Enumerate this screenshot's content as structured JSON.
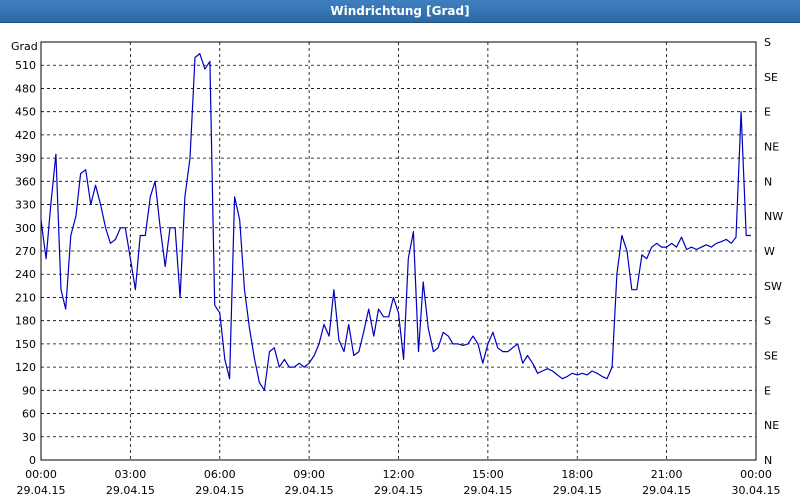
{
  "window": {
    "title": "Windrichtung [Grad]"
  },
  "chart_data": {
    "type": "line",
    "title": "Windrichtung [Grad]",
    "ylabel": "Grad",
    "ylim": [
      0,
      540
    ],
    "y_ticks": [
      0,
      30,
      60,
      90,
      120,
      150,
      180,
      210,
      240,
      270,
      300,
      330,
      360,
      390,
      420,
      450,
      480,
      510
    ],
    "right_axis_ticks": [
      {
        "value": 0,
        "label": "N"
      },
      {
        "value": 45,
        "label": "NE"
      },
      {
        "value": 90,
        "label": "E"
      },
      {
        "value": 135,
        "label": "SE"
      },
      {
        "value": 180,
        "label": "S"
      },
      {
        "value": 225,
        "label": "SW"
      },
      {
        "value": 270,
        "label": "W"
      },
      {
        "value": 315,
        "label": "NW"
      },
      {
        "value": 360,
        "label": "N"
      },
      {
        "value": 405,
        "label": "NE"
      },
      {
        "value": 450,
        "label": "E"
      },
      {
        "value": 495,
        "label": "SE"
      },
      {
        "value": 540,
        "label": "S"
      }
    ],
    "x_range_hours": [
      0,
      24
    ],
    "x_ticks": [
      {
        "hour": 0,
        "time": "00:00",
        "date": "29.04.15"
      },
      {
        "hour": 3,
        "time": "03:00",
        "date": "29.04.15"
      },
      {
        "hour": 6,
        "time": "06:00",
        "date": "29.04.15"
      },
      {
        "hour": 9,
        "time": "09:00",
        "date": "29.04.15"
      },
      {
        "hour": 12,
        "time": "12:00",
        "date": "29.04.15"
      },
      {
        "hour": 15,
        "time": "15:00",
        "date": "29.04.15"
      },
      {
        "hour": 18,
        "time": "18:00",
        "date": "29.04.15"
      },
      {
        "hour": 21,
        "time": "21:00",
        "date": "29.04.15"
      },
      {
        "hour": 24,
        "time": "00:00",
        "date": "30.04.15"
      }
    ],
    "grid": true,
    "series": [
      {
        "color": "#0000c0",
        "points": [
          [
            0.0,
            310
          ],
          [
            0.17,
            260
          ],
          [
            0.33,
            330
          ],
          [
            0.5,
            395
          ],
          [
            0.67,
            220
          ],
          [
            0.83,
            195
          ],
          [
            1.0,
            290
          ],
          [
            1.17,
            315
          ],
          [
            1.33,
            370
          ],
          [
            1.5,
            375
          ],
          [
            1.67,
            330
          ],
          [
            1.83,
            355
          ],
          [
            2.0,
            330
          ],
          [
            2.17,
            300
          ],
          [
            2.33,
            280
          ],
          [
            2.5,
            285
          ],
          [
            2.67,
            300
          ],
          [
            2.83,
            300
          ],
          [
            3.0,
            260
          ],
          [
            3.17,
            220
          ],
          [
            3.33,
            290
          ],
          [
            3.5,
            290
          ],
          [
            3.67,
            340
          ],
          [
            3.83,
            360
          ],
          [
            4.0,
            300
          ],
          [
            4.17,
            250
          ],
          [
            4.33,
            300
          ],
          [
            4.5,
            300
          ],
          [
            4.67,
            210
          ],
          [
            4.83,
            340
          ],
          [
            5.0,
            390
          ],
          [
            5.17,
            520
          ],
          [
            5.33,
            525
          ],
          [
            5.5,
            505
          ],
          [
            5.67,
            515
          ],
          [
            5.83,
            200
          ],
          [
            6.0,
            190
          ],
          [
            6.17,
            130
          ],
          [
            6.33,
            105
          ],
          [
            6.5,
            340
          ],
          [
            6.67,
            310
          ],
          [
            6.83,
            220
          ],
          [
            7.0,
            170
          ],
          [
            7.17,
            130
          ],
          [
            7.33,
            100
          ],
          [
            7.5,
            90
          ],
          [
            7.67,
            140
          ],
          [
            7.83,
            145
          ],
          [
            8.0,
            120
          ],
          [
            8.17,
            130
          ],
          [
            8.33,
            120
          ],
          [
            8.5,
            120
          ],
          [
            8.67,
            125
          ],
          [
            8.83,
            120
          ],
          [
            9.0,
            125
          ],
          [
            9.17,
            135
          ],
          [
            9.33,
            150
          ],
          [
            9.5,
            175
          ],
          [
            9.67,
            160
          ],
          [
            9.83,
            220
          ],
          [
            10.0,
            155
          ],
          [
            10.17,
            140
          ],
          [
            10.33,
            175
          ],
          [
            10.5,
            135
          ],
          [
            10.67,
            140
          ],
          [
            10.83,
            165
          ],
          [
            11.0,
            195
          ],
          [
            11.17,
            160
          ],
          [
            11.33,
            195
          ],
          [
            11.5,
            185
          ],
          [
            11.67,
            185
          ],
          [
            11.83,
            210
          ],
          [
            12.0,
            190
          ],
          [
            12.17,
            130
          ],
          [
            12.33,
            260
          ],
          [
            12.5,
            295
          ],
          [
            12.67,
            140
          ],
          [
            12.83,
            230
          ],
          [
            13.0,
            170
          ],
          [
            13.17,
            140
          ],
          [
            13.33,
            145
          ],
          [
            13.5,
            165
          ],
          [
            13.67,
            160
          ],
          [
            13.83,
            150
          ],
          [
            14.0,
            150
          ],
          [
            14.17,
            148
          ],
          [
            14.33,
            150
          ],
          [
            14.5,
            160
          ],
          [
            14.67,
            150
          ],
          [
            14.83,
            125
          ],
          [
            15.0,
            150
          ],
          [
            15.17,
            165
          ],
          [
            15.33,
            145
          ],
          [
            15.5,
            140
          ],
          [
            15.67,
            140
          ],
          [
            15.83,
            145
          ],
          [
            16.0,
            150
          ],
          [
            16.17,
            125
          ],
          [
            16.33,
            135
          ],
          [
            16.5,
            125
          ],
          [
            16.67,
            112
          ],
          [
            16.83,
            115
          ],
          [
            17.0,
            118
          ],
          [
            17.17,
            115
          ],
          [
            17.33,
            110
          ],
          [
            17.5,
            105
          ],
          [
            17.67,
            108
          ],
          [
            17.83,
            112
          ],
          [
            18.0,
            110
          ],
          [
            18.17,
            112
          ],
          [
            18.33,
            110
          ],
          [
            18.5,
            115
          ],
          [
            18.67,
            112
          ],
          [
            18.83,
            108
          ],
          [
            19.0,
            105
          ],
          [
            19.17,
            120
          ],
          [
            19.33,
            240
          ],
          [
            19.5,
            290
          ],
          [
            19.67,
            270
          ],
          [
            19.83,
            220
          ],
          [
            20.0,
            220
          ],
          [
            20.17,
            265
          ],
          [
            20.33,
            260
          ],
          [
            20.5,
            275
          ],
          [
            20.67,
            280
          ],
          [
            20.83,
            275
          ],
          [
            21.0,
            275
          ],
          [
            21.17,
            280
          ],
          [
            21.33,
            275
          ],
          [
            21.5,
            288
          ],
          [
            21.67,
            272
          ],
          [
            21.83,
            275
          ],
          [
            22.0,
            272
          ],
          [
            22.17,
            275
          ],
          [
            22.33,
            278
          ],
          [
            22.5,
            275
          ],
          [
            22.67,
            280
          ],
          [
            22.83,
            282
          ],
          [
            23.0,
            285
          ],
          [
            23.17,
            280
          ],
          [
            23.33,
            288
          ],
          [
            23.5,
            450
          ],
          [
            23.67,
            290
          ],
          [
            23.83,
            290
          ]
        ]
      }
    ]
  }
}
